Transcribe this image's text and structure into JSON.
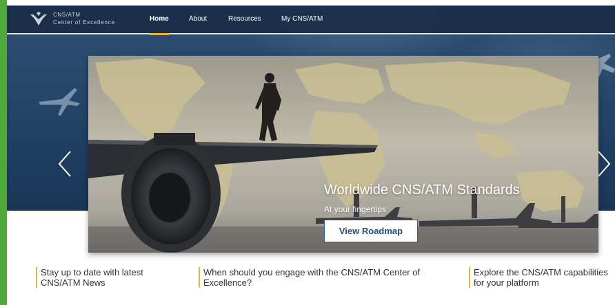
{
  "brand": {
    "line1": "CNS/ATM",
    "line2": "Center of Excellence"
  },
  "nav": {
    "items": [
      {
        "label": "Home",
        "active": true
      },
      {
        "label": "About"
      },
      {
        "label": "Resources"
      },
      {
        "label": "My CNS/ATM"
      }
    ]
  },
  "carousel": {
    "prev_icon": "chevron-left-icon",
    "next_icon": "chevron-right-icon",
    "slide": {
      "title": "Worldwide CNS/ATM Standards",
      "subtitle": "At your fingertips",
      "button_label": "View Roadmap"
    }
  },
  "info_links": [
    {
      "text": "Stay up to date with latest CNS/ATM News"
    },
    {
      "text": "When should you engage with the CNS/ATM Center of Excellence?"
    },
    {
      "text": "Explore the CNS/ATM capabilities for your platform"
    }
  ],
  "colors": {
    "accent": "#e8b33a",
    "nav_bg": "#1a2d46",
    "hero_bg": "#28486c",
    "button_text": "#1f4e84",
    "frame": "#4fa83a"
  }
}
